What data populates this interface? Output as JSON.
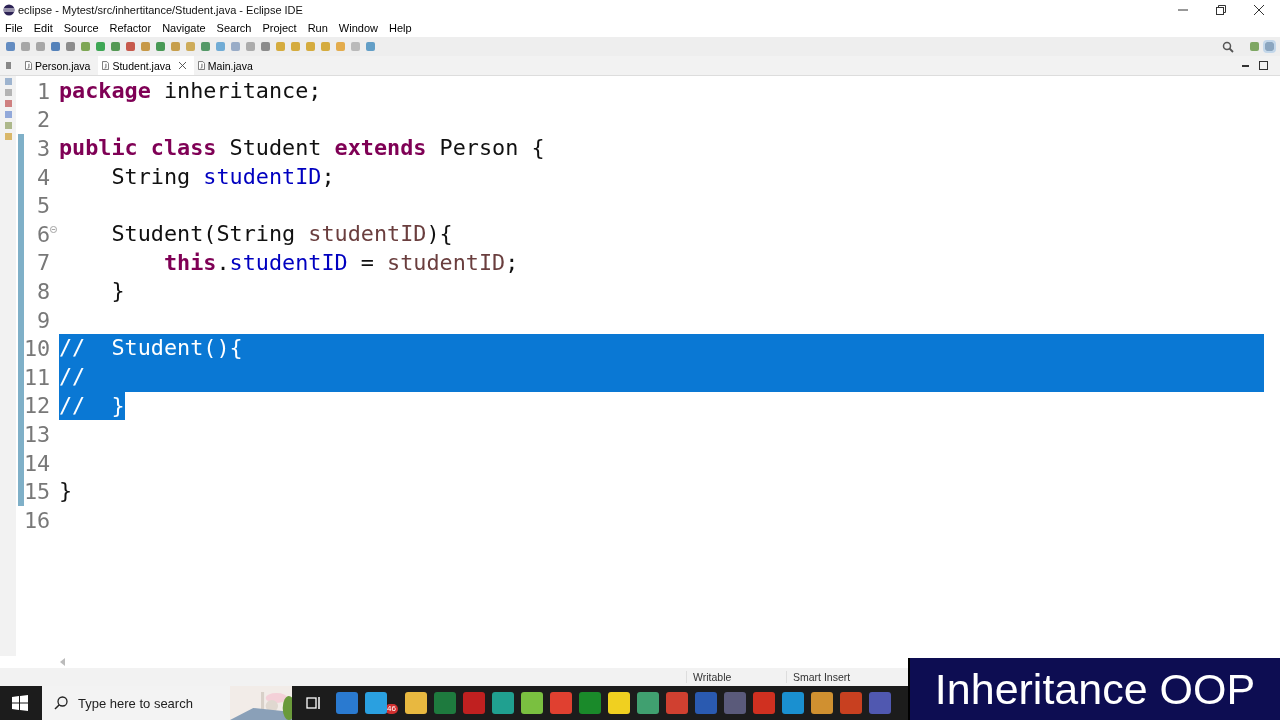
{
  "window": {
    "title": "eclipse - Mytest/src/inhertitance/Student.java - Eclipse IDE"
  },
  "menu": [
    "File",
    "Edit",
    "Source",
    "Refactor",
    "Navigate",
    "Search",
    "Project",
    "Run",
    "Window",
    "Help"
  ],
  "tabs": [
    {
      "label": "Person.java",
      "selected": false,
      "closable": false
    },
    {
      "label": "Student.java",
      "selected": true,
      "closable": true
    },
    {
      "label": "Main.java",
      "selected": false,
      "closable": false
    }
  ],
  "editor": {
    "lines": [
      {
        "number": "1",
        "range": false,
        "fold": false,
        "selected": false,
        "tokens": [
          {
            "kind": "keyword",
            "text": "package"
          },
          {
            "kind": "plain",
            "text": " inheritance;"
          }
        ]
      },
      {
        "number": "2",
        "range": false,
        "fold": false,
        "selected": false
      },
      {
        "number": "3",
        "range": true,
        "fold": false,
        "selected": false,
        "tokens": [
          {
            "kind": "keyword",
            "text": "public"
          },
          {
            "kind": "keyword",
            "text": " class"
          },
          {
            "kind": "plain",
            "text": " Student "
          },
          {
            "kind": "keyword",
            "text": "extends"
          },
          {
            "kind": "plain",
            "text": " Person {"
          }
        ]
      },
      {
        "number": "4",
        "range": true,
        "fold": false,
        "selected": false,
        "tokens": [
          {
            "kind": "plain",
            "text": "    String "
          },
          {
            "kind": "field",
            "text": "studentID"
          },
          {
            "kind": "plain",
            "text": ";"
          }
        ]
      },
      {
        "number": "5",
        "range": true,
        "fold": false,
        "selected": false
      },
      {
        "number": "6",
        "range": true,
        "fold": true,
        "selected": false,
        "tokens": [
          {
            "kind": "plain",
            "text": "    Student(String "
          },
          {
            "kind": "param",
            "text": "studentID"
          },
          {
            "kind": "plain",
            "text": "){"
          }
        ]
      },
      {
        "number": "7",
        "range": true,
        "fold": false,
        "selected": false,
        "tokens": [
          {
            "kind": "keyword",
            "text": "        this"
          },
          {
            "kind": "plain",
            "text": "."
          },
          {
            "kind": "field",
            "text": "studentID"
          },
          {
            "kind": "plain",
            "text": " = "
          },
          {
            "kind": "param",
            "text": "studentID"
          },
          {
            "kind": "plain",
            "text": ";"
          }
        ]
      },
      {
        "number": "8",
        "range": true,
        "fold": false,
        "selected": false,
        "tokens": [
          {
            "kind": "plain",
            "text": "    }"
          }
        ]
      },
      {
        "number": "9",
        "range": true,
        "fold": false,
        "selected": false
      },
      {
        "number": "10",
        "range": true,
        "fold": false,
        "selected": true,
        "selection_end": false,
        "tokens": [
          {
            "kind": "plain",
            "text": "//  Student(){"
          }
        ]
      },
      {
        "number": "11",
        "range": true,
        "fold": false,
        "selected": true,
        "selection_end": false,
        "tokens": [
          {
            "kind": "plain",
            "text": "//"
          }
        ]
      },
      {
        "number": "12",
        "range": true,
        "fold": false,
        "selected": true,
        "selection_end": true,
        "tokens": [
          {
            "kind": "plain",
            "text": "//  }"
          }
        ]
      },
      {
        "number": "13",
        "range": true,
        "fold": false,
        "selected": false
      },
      {
        "number": "14",
        "range": true,
        "fold": false,
        "selected": false
      },
      {
        "number": "15",
        "range": true,
        "fold": false,
        "selected": false,
        "tokens": [
          {
            "kind": "plain",
            "text": "}"
          }
        ]
      },
      {
        "number": "16",
        "range": false,
        "fold": false,
        "selected": false
      }
    ]
  },
  "status_bar": [
    "Writable",
    "Smart Insert"
  ],
  "taskbar": {
    "search": {
      "placeholder": "Type here to search"
    },
    "badge": "46"
  },
  "caption": "Inheritance OOP"
}
